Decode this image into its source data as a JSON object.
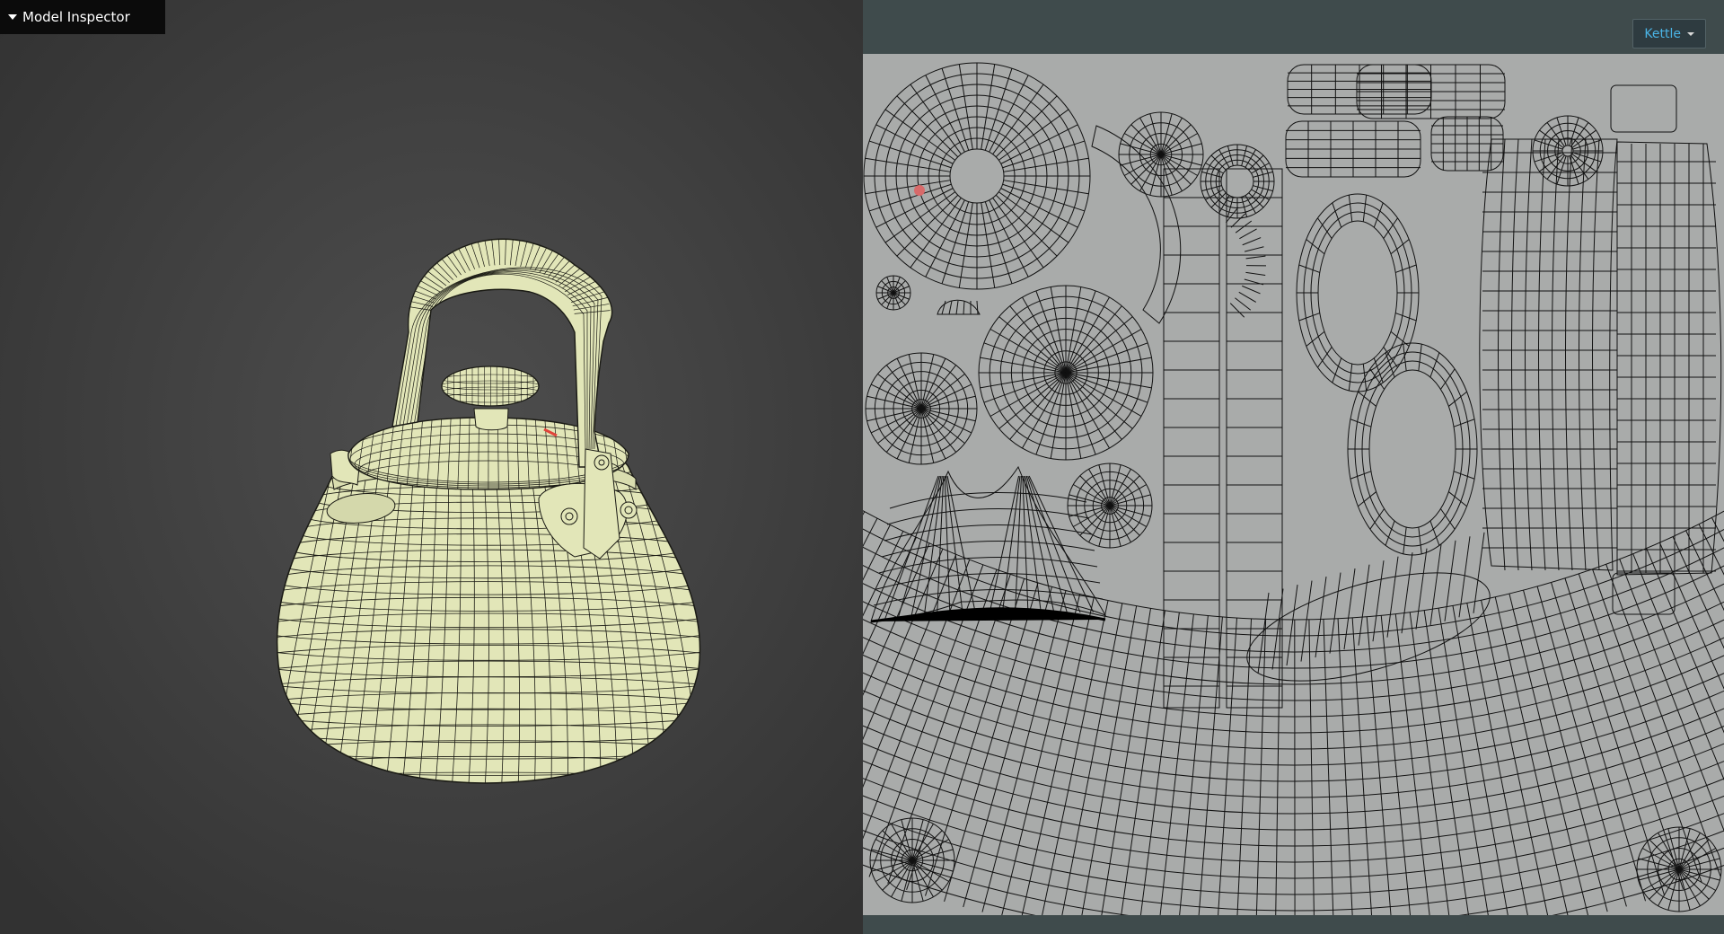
{
  "panel": {
    "title": "Model Inspector"
  },
  "model_selector": {
    "selected": "Kettle"
  },
  "icons": [
    "collapse-triangle-icon",
    "dropdown-caret-icon"
  ],
  "colors": {
    "viewport_bg": "#3c3c3c",
    "wire_fill": "#e2e6b8",
    "wire_line": "#1a1a14",
    "uv_bg": "#a9abaa",
    "uv_panel_bg": "#3f4b4c",
    "select_text": "#4ab4e6",
    "highlight": "#e0443a"
  }
}
